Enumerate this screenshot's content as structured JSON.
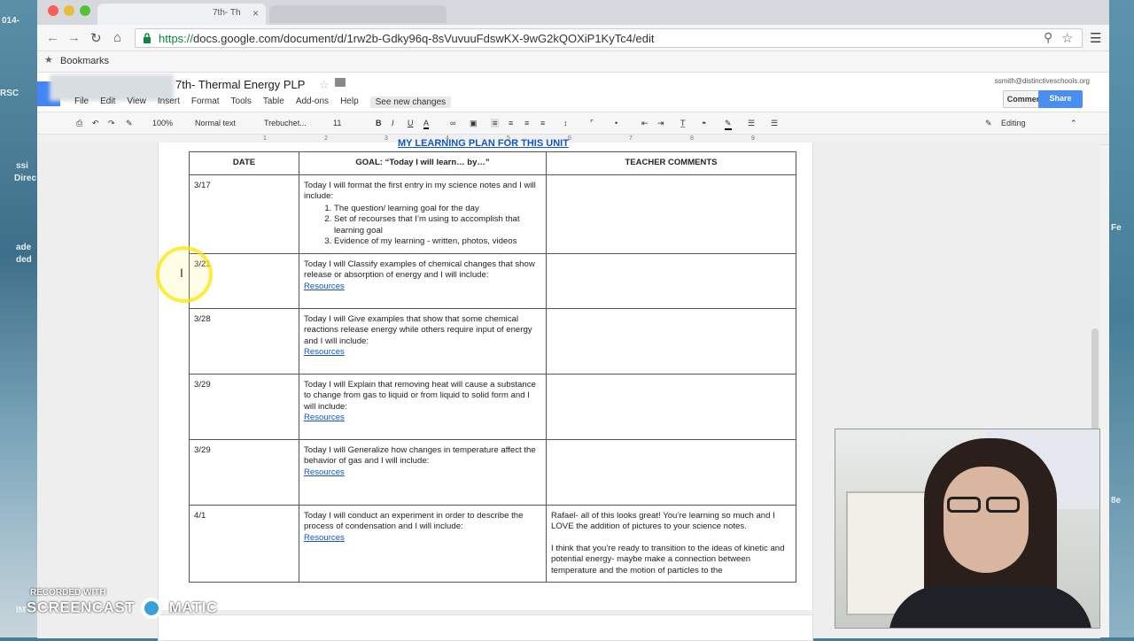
{
  "browser": {
    "tab_title": "7th- Th",
    "tab_close": "×",
    "url_scheme": "https://",
    "url_rest": "docs.google.com/document/d/1rw2b-Gdky96q-8sVuvuuFdswKX-9wG2kQOXiP1KyTc4/edit",
    "bookmarks_label": "Bookmarks"
  },
  "doc": {
    "title": "7th- Thermal Energy PLP",
    "account": "ssmith@distinctiveschools.org",
    "comments_label": "Comments",
    "share_label": "Share",
    "menu": [
      "File",
      "Edit",
      "View",
      "Insert",
      "Format",
      "Tools",
      "Table",
      "Add-ons",
      "Help"
    ],
    "see_changes": "See new changes",
    "zoom": "100%",
    "style": "Normal text",
    "font": "Trebuchet...",
    "font_size": "11",
    "mode": "Editing",
    "heading_partial": "MY LEARNING PLAN FOR THIS UNIT"
  },
  "table": {
    "headers": [
      "DATE",
      "GOAL:  “Today I will learn… by…”",
      "TEACHER COMMENTS"
    ],
    "rows": [
      {
        "date": "3/17",
        "goal": "Today I will format the first entry in my science notes and I will include:",
        "list": [
          "The question/ learning goal for the day",
          "Set of recourses that I’m using to accomplish that learning goal",
          "Evidence of my learning - written, photos, videos"
        ],
        "link": "",
        "comment": ""
      },
      {
        "date": "3/21",
        "goal": "Today I will Classify examples of chemical changes that show release or absorption of energy and I will include:",
        "list": [],
        "link": "Resources",
        "comment": ""
      },
      {
        "date": "3/28",
        "goal": "Today I will Give examples that show that some chemical reactions release energy while others require input of energy and I will include:",
        "list": [],
        "link": "Resources",
        "comment": ""
      },
      {
        "date": "3/29",
        "goal": "Today I will Explain that removing heat will cause a substance to change from gas to liquid or from liquid to solid form and I will include:",
        "list": [],
        "link": "Resources",
        "comment": ""
      },
      {
        "date": "3/29",
        "goal": "Today I will Generalize how changes in temperature affect the behavior of gas and I will include:",
        "list": [],
        "link": "Resources",
        "comment": ""
      },
      {
        "date": "4/1",
        "goal": "Today I will conduct an experiment in order to describe the process of condensation and I will include:",
        "list": [],
        "link": "Resources",
        "comment": "Rafael- all of this looks great! You’re learning so much and I LOVE the addition of pictures to your science notes.",
        "comment2": "I think that you’re ready to transition to the ideas of kinetic and potential energy- maybe make a connection between temperature and the motion of particles to the"
      }
    ]
  },
  "watermark": {
    "line1": "RECORDED WITH",
    "line2a": "SCREENCAST",
    "line2b": "MATIC"
  },
  "desktop": {
    "left_texts": [
      "014-",
      "RSC",
      "ssi",
      "Direc",
      "ade",
      "ded",
      "IM"
    ],
    "right_texts": [
      "Fe",
      "8e"
    ]
  },
  "colors": {
    "link": "#1155cc",
    "share_button": "#4a8ff0",
    "url_https": "#0a8a3a"
  }
}
